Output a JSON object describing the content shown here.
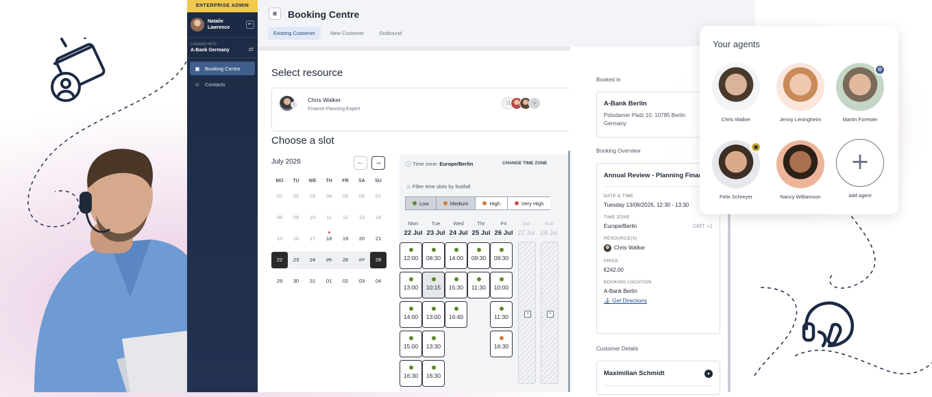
{
  "sidebar": {
    "banner": "ENTERPRISE ADMIN",
    "user_name": "Natalie Lawrence",
    "logged_label": "LOGGED INTO",
    "logged_value": "A-Bank Germany",
    "items": [
      {
        "label": "Booking Centre",
        "icon": "calendar-icon"
      },
      {
        "label": "Contacts",
        "icon": "contacts-icon"
      }
    ]
  },
  "header": {
    "title": "Booking Centre",
    "tabs": [
      "Existing Customer",
      "New Customer",
      "Outbound"
    ]
  },
  "resource": {
    "heading": "Select resource",
    "name": "Chris Walker",
    "role": "Finance Planning Expert"
  },
  "slot_picker": {
    "heading": "Choose a slot",
    "month": "July 2026",
    "weekdays": [
      "MO",
      "TU",
      "WE",
      "TH",
      "FR",
      "SA",
      "SU"
    ],
    "weeks": [
      [
        "01",
        "02",
        "03",
        "04",
        "05",
        "06",
        "07"
      ],
      [
        "08",
        "09",
        "10",
        "11",
        "12",
        "13",
        "14"
      ],
      [
        "15",
        "16",
        "17",
        "18",
        "19",
        "20",
        "21"
      ],
      [
        "22",
        "23",
        "24",
        "25",
        "26",
        "27",
        "28"
      ],
      [
        "29",
        "30",
        "31",
        "01",
        "02",
        "03",
        "04"
      ]
    ],
    "timezone_label": "Time zone:",
    "timezone_value": "Europe/Berlin",
    "change_tz": "CHANGE TIME ZONE",
    "filter_label": "Filter time slots by footfall",
    "footfall": [
      {
        "label": "Low",
        "color": "#5a8a2b"
      },
      {
        "label": "Medium",
        "color": "#c9803a"
      },
      {
        "label": "High",
        "color": "#c9803a"
      },
      {
        "label": "Very High",
        "color": "#d14d4d"
      }
    ],
    "days": [
      {
        "name": "Mon",
        "date": "22 Jul",
        "slots": [
          "12:00",
          "13:00",
          "14:00",
          "15:00",
          "16:30"
        ]
      },
      {
        "name": "Tue",
        "date": "23 Jul",
        "slots": [
          "08:30",
          "10:15",
          "13:00",
          "13:30",
          "16:30"
        ]
      },
      {
        "name": "Wed",
        "date": "24 Jul",
        "slots": [
          "14:00",
          "15:30",
          "16:40"
        ]
      },
      {
        "name": "Thr",
        "date": "25 Jul",
        "slots": [
          "09:30",
          "11:30"
        ]
      },
      {
        "name": "Fri",
        "date": "26 Jul",
        "slots": [
          "09:30",
          "10:00",
          "11:30",
          "16:30"
        ]
      },
      {
        "name": "Sat",
        "date": "27 Jul",
        "slots": []
      },
      {
        "name": "Sun",
        "date": "28 Jul",
        "slots": []
      }
    ]
  },
  "summary": {
    "booked_in_label": "Booked in",
    "branch_name": "A-Bank Berlin",
    "branch_addr1": "Potsdamer Platz 10, 10785 Berlin",
    "branch_addr2": "Germany",
    "overview_label": "Booking Overview",
    "overview_title": "Annual Review - Planning Finance",
    "date_label": "DATE & TIME",
    "date_value": "Tuesday 13/06/2026, 12:30 - 13:30",
    "tz_label": "TIME ZONE",
    "tz_value": "Europe/Berlin",
    "tz_offset": "GMT +1",
    "resource_label": "RESOURCE(S)",
    "resource_value": "Chris Walker",
    "price_label": "PRICE",
    "price_value": "€242,00",
    "location_label": "BOOKING LOCATION",
    "location_value": "A-Bank Berlin",
    "directions": "Get Directions",
    "customer_label": "Customer Details",
    "customer_name": "Maximilian Schmidt"
  },
  "agents": {
    "title": "Your agents",
    "list": [
      "Chris Walker",
      "Jenny Leningheim",
      "Martin Forester",
      "Felix Schreyer",
      "Nancy Williamson"
    ],
    "add": "add agent"
  }
}
